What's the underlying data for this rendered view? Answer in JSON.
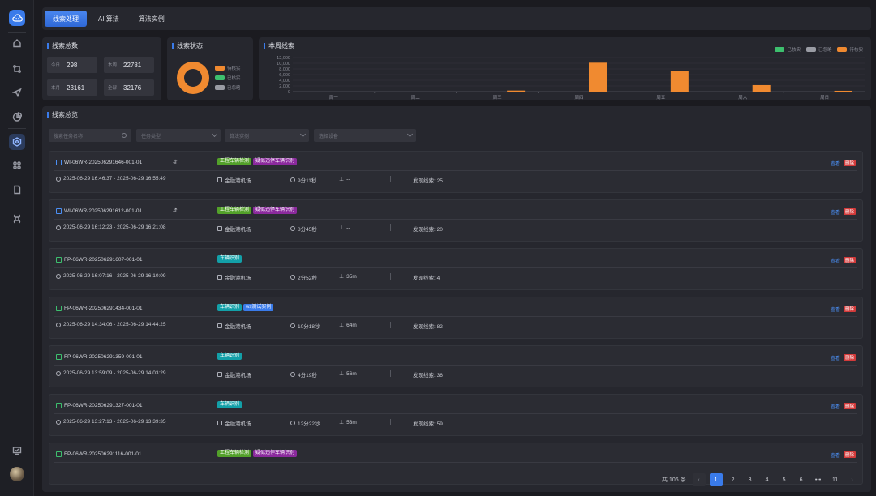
{
  "sidebar": {
    "items": [
      "home-icon",
      "route-icon",
      "send-icon",
      "pie-icon",
      "analysis-icon",
      "apps-icon",
      "document-icon",
      "command-icon"
    ],
    "active": "analysis-icon",
    "bottom": [
      "monitor-icon"
    ]
  },
  "tabs": [
    {
      "label": "线索处理",
      "active": true
    },
    {
      "label": "AI 算法",
      "active": false
    },
    {
      "label": "算法实例",
      "active": false
    }
  ],
  "summary": {
    "title": "线索总数",
    "stats": [
      {
        "label": "今日",
        "value": "298"
      },
      {
        "label": "本周",
        "value": "22781"
      },
      {
        "label": "本月",
        "value": "23161"
      },
      {
        "label": "全部",
        "value": "32176"
      }
    ]
  },
  "status": {
    "title": "线索状态",
    "legend": [
      {
        "label": "待核实",
        "color": "#f08a30"
      },
      {
        "label": "已核实",
        "color": "#3dbf6e"
      },
      {
        "label": "已忽略",
        "color": "#9a9ca4"
      }
    ],
    "donut_fraction_pending": 1.0
  },
  "weekly": {
    "title": "本周线索",
    "legend": [
      {
        "label": "已核实",
        "color": "#3dbf6e"
      },
      {
        "label": "已忽略",
        "color": "#9a9ca4"
      },
      {
        "label": "待核实",
        "color": "#f08a30"
      }
    ]
  },
  "chart_data": {
    "type": "bar",
    "categories": [
      "周一",
      "周二",
      "周三",
      "周四",
      "周五",
      "周六",
      "周日"
    ],
    "series": [
      {
        "name": "已核实",
        "values": [
          0,
          0,
          0,
          0,
          0,
          0,
          0
        ]
      },
      {
        "name": "已忽略",
        "values": [
          0,
          0,
          0,
          0,
          0,
          0,
          0
        ]
      },
      {
        "name": "待核实",
        "values": [
          0,
          0,
          380,
          10200,
          7400,
          2300,
          298
        ]
      }
    ],
    "yticks": [
      "12,000",
      "10,000",
      "8,000",
      "6,000",
      "4,000",
      "2,000",
      "0"
    ],
    "ylim": [
      0,
      12000
    ],
    "grid": true,
    "legend_position": "top-right"
  },
  "overview": {
    "title": "线索总览",
    "filters": [
      {
        "placeholder": "搜索任务名称"
      },
      {
        "placeholder": "任务类型"
      },
      {
        "placeholder": "算法实例"
      },
      {
        "placeholder": "选择设备"
      }
    ],
    "tasks": [
      {
        "id": "WI-06WR-202506291646-001-01",
        "type": "wi",
        "sync": "⇵",
        "tags": [
          {
            "t": "工程车辆检测",
            "c": "green"
          },
          {
            "t": "疑似违停车辆识别",
            "c": "purple"
          }
        ],
        "time": "2025-06-29 16:46:37 - 2025-06-29 16:55:49",
        "place": "金融港机场",
        "duration": "9分11秒",
        "height": "--",
        "found": "发现线索: 25"
      },
      {
        "id": "WI-06WR-202506291612-001-01",
        "type": "wi",
        "sync": "⇵",
        "tags": [
          {
            "t": "工程车辆检测",
            "c": "green"
          },
          {
            "t": "疑似违停车辆识别",
            "c": "purple"
          }
        ],
        "time": "2025-06-29 16:12:23 - 2025-06-29 16:21:08",
        "place": "金融港机场",
        "duration": "8分45秒",
        "height": "--",
        "found": "发现线索: 20"
      },
      {
        "id": "FP-06WR-202506291607-001-01",
        "type": "fp",
        "sync": "",
        "tags": [
          {
            "t": "车辆识别",
            "c": "teal"
          }
        ],
        "time": "2025-06-29 16:07:16 - 2025-06-29 16:10:09",
        "place": "金融港机场",
        "duration": "2分52秒",
        "height": "35m",
        "found": "发现线索: 4"
      },
      {
        "id": "FP-06WR-202506291434-001-01",
        "type": "fp",
        "sync": "",
        "tags": [
          {
            "t": "车辆识别",
            "c": "teal"
          },
          {
            "t": "ws测试实例",
            "c": "blue"
          }
        ],
        "time": "2025-06-29 14:34:06 - 2025-06-29 14:44:25",
        "place": "金融港机场",
        "duration": "10分18秒",
        "height": "64m",
        "found": "发现线索: 82"
      },
      {
        "id": "FP-06WR-202506291359-001-01",
        "type": "fp",
        "sync": "",
        "tags": [
          {
            "t": "车辆识别",
            "c": "teal"
          }
        ],
        "time": "2025-06-29 13:59:09 - 2025-06-29 14:03:29",
        "place": "金融港机场",
        "duration": "4分19秒",
        "height": "56m",
        "found": "发现线索: 36"
      },
      {
        "id": "FP-06WR-202506291327-001-01",
        "type": "fp",
        "sync": "",
        "tags": [
          {
            "t": "车辆识别",
            "c": "teal"
          }
        ],
        "time": "2025-06-29 13:27:13 - 2025-06-29 13:39:35",
        "place": "金融港机场",
        "duration": "12分22秒",
        "height": "53m",
        "found": "发现线索: 59"
      },
      {
        "id": "FP-06WR-202506291116-001-01",
        "type": "fp",
        "sync": "",
        "tags": [
          {
            "t": "工程车辆检测",
            "c": "green"
          },
          {
            "t": "疑似违停车辆识别",
            "c": "purple"
          }
        ],
        "time": "",
        "place": "",
        "duration": "",
        "height": "",
        "found": ""
      }
    ],
    "view_label": "查看",
    "delete_label": "删除"
  },
  "pagination": {
    "total": "共 106 条",
    "pages": [
      "1",
      "2",
      "3",
      "4",
      "5",
      "6",
      "•••",
      "11"
    ],
    "current": "1"
  }
}
